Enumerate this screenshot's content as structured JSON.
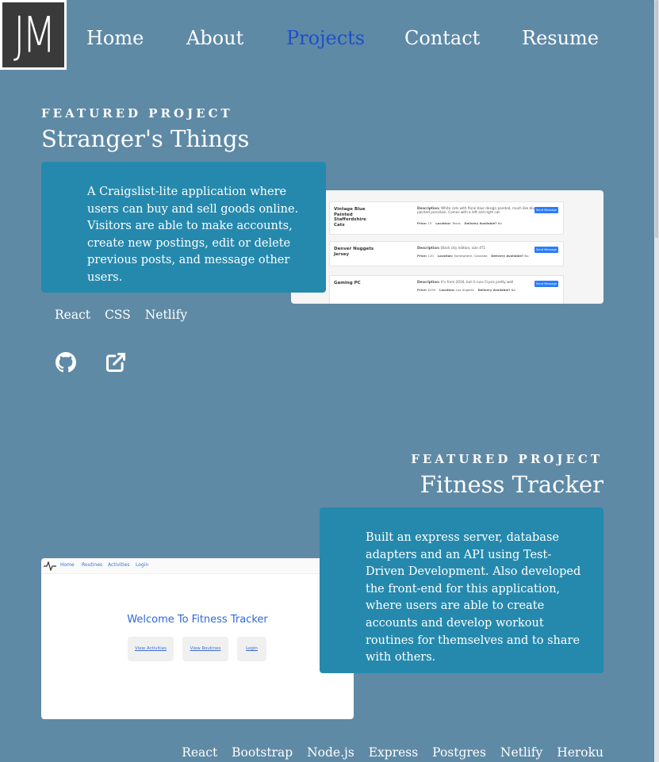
{
  "logo": {
    "text": "JM"
  },
  "nav": {
    "items": [
      {
        "label": "Home",
        "active": false
      },
      {
        "label": "About",
        "active": false
      },
      {
        "label": "Projects",
        "active": true
      },
      {
        "label": "Contact",
        "active": false
      },
      {
        "label": "Resume",
        "active": false
      }
    ]
  },
  "colors": {
    "background": "#5f8aa6",
    "card": "#2589ae",
    "nav_active": "#1f4fc8",
    "text": "#ffffff"
  },
  "projects": [
    {
      "eyebrow": "FEATURED PROJECT",
      "title": "Stranger's Things",
      "description": "A Craigslist-lite application where users can buy and sell goods online. Visitors are able to make accounts, create new postings, edit or delete previous posts, and message other users.",
      "tags": [
        "React",
        "CSS",
        "Netlify"
      ],
      "links": [
        {
          "icon": "github-icon"
        },
        {
          "icon": "external-link-icon"
        }
      ],
      "screenshot": {
        "listings": [
          {
            "title": "Vintage Blue Painted Staffordshire Cats",
            "description_label": "Description:",
            "description": "White cats with floral blue design painted, much like blue painted porcelain. Comes with a left and right cat.",
            "price_label": "Price:",
            "price": "15",
            "location_label": "Location:",
            "location": "Texas",
            "delivery_label": "Delivery Available?",
            "delivery": "No",
            "button": "Send Message"
          },
          {
            "title": "Denver Nuggets Jersey",
            "description_label": "Description:",
            "description": "Black city edition, size 4T1",
            "price_label": "Price:",
            "price": "120",
            "location_label": "Location:",
            "location": "Somewhere, Colorado",
            "delivery_label": "Delivery Available?",
            "delivery": "No",
            "button": "Send Message"
          },
          {
            "title": "Gaming PC",
            "description_label": "Description:",
            "description": "It's from 2016, but it runs Crysis pretty well",
            "price_label": "Price:",
            "price": "$250",
            "location_label": "Location:",
            "location": "Los Angeles",
            "delivery_label": "Delivery Available?",
            "delivery": "No",
            "button": "Send Message"
          }
        ]
      }
    },
    {
      "eyebrow": "FEATURED PROJECT",
      "title": "Fitness Tracker",
      "description": "Built an express server, database adapters and an API using Test-Driven Development. Also developed the front-end for this application, where users are able to create accounts and develop workout routines for themselves and to share with others.",
      "tags": [
        "React",
        "Bootstrap",
        "Node.js",
        "Express",
        "Postgres",
        "Netlify",
        "Heroku"
      ],
      "screenshot": {
        "nav": [
          "Home",
          "Routines",
          "Activities",
          "Login"
        ],
        "welcome": "Welcome To Fitness Tracker",
        "buttons": [
          "View Activities",
          "View Routines",
          "Login"
        ]
      }
    }
  ]
}
